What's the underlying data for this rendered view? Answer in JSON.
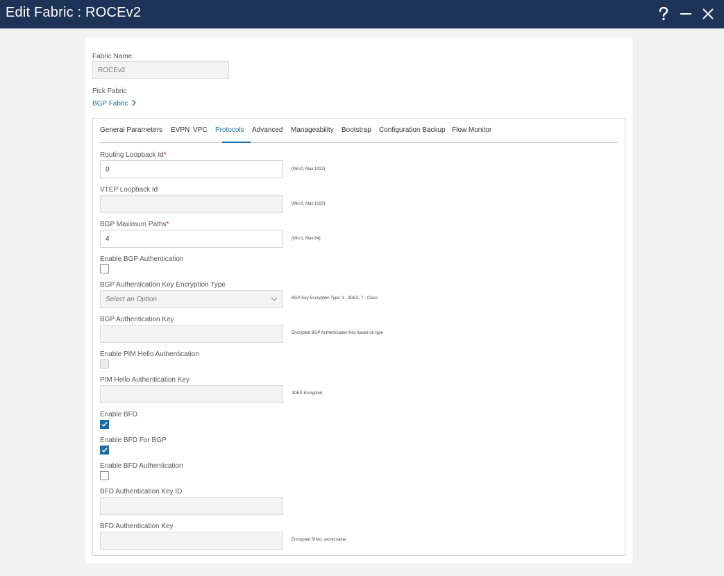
{
  "window": {
    "title": "Edit Fabric : ROCEv2",
    "icons": [
      "help-icon",
      "minimize-icon",
      "close-icon"
    ]
  },
  "form": {
    "fabric_name_label": "Fabric Name",
    "fabric_name_value": "ROCEv2",
    "pick_fabric_label": "Pick Fabric",
    "pick_fabric_link": "BGP Fabric"
  },
  "tabs": [
    {
      "label": "General Parameters",
      "active": false
    },
    {
      "label": "EVPN",
      "active": false
    },
    {
      "label": "VPC",
      "active": false
    },
    {
      "label": "Protocols",
      "active": true
    },
    {
      "label": "Advanced",
      "active": false
    },
    {
      "label": "Manageability",
      "active": false
    },
    {
      "label": "Bootstrap",
      "active": false
    },
    {
      "label": "Configuration Backup",
      "active": false
    },
    {
      "label": "Flow Monitor",
      "active": false
    }
  ],
  "protocols": {
    "routing_loopback": {
      "label": "Routing Loopback Id",
      "required": "*",
      "value": "0",
      "hint": "(Min:0, Max:1023)"
    },
    "vtep_loopback": {
      "label": "VTEP Loopback Id",
      "value": "",
      "hint": "(Min:0, Max:1023)"
    },
    "bgp_max_paths": {
      "label": "BGP Maximum Paths",
      "required": "*",
      "value": "4",
      "hint": "(Min:1, Max:64)"
    },
    "enable_bgp_auth": {
      "label": "Enable BGP Authentication",
      "checked": false
    },
    "bgp_auth_key_enc_type": {
      "label": "BGP Authentication Key Encryption Type",
      "placeholder": "Select an Option",
      "hint": "BGP Key Encryption Type: 3 - 3DES, 7 - Cisco"
    },
    "bgp_auth_key": {
      "label": "BGP Authentication Key",
      "value": "",
      "hint": "Encrypted BGP Authentication Key based on type"
    },
    "enable_pim_hello_auth": {
      "label": "Enable PIM Hello Authentication",
      "checked": false
    },
    "pim_hello_auth_key": {
      "label": "PIM Hello Authentication Key",
      "value": "",
      "hint": "3DES Encrypted"
    },
    "enable_bfd": {
      "label": "Enable BFD",
      "checked": true
    },
    "enable_bfd_bgp": {
      "label": "Enable BFD For BGP",
      "checked": true
    },
    "enable_bfd_auth": {
      "label": "Enable BFD Authentication",
      "checked": false
    },
    "bfd_auth_key_id": {
      "label": "BFD Authentication Key ID",
      "value": ""
    },
    "bfd_auth_key": {
      "label": "BFD Authentication Key",
      "value": "",
      "hint": "Encrypted SHA1 secret value"
    }
  },
  "colors": {
    "titlebar": "#1e3358",
    "accent": "#1c6ca1",
    "required": "#d0021b"
  }
}
